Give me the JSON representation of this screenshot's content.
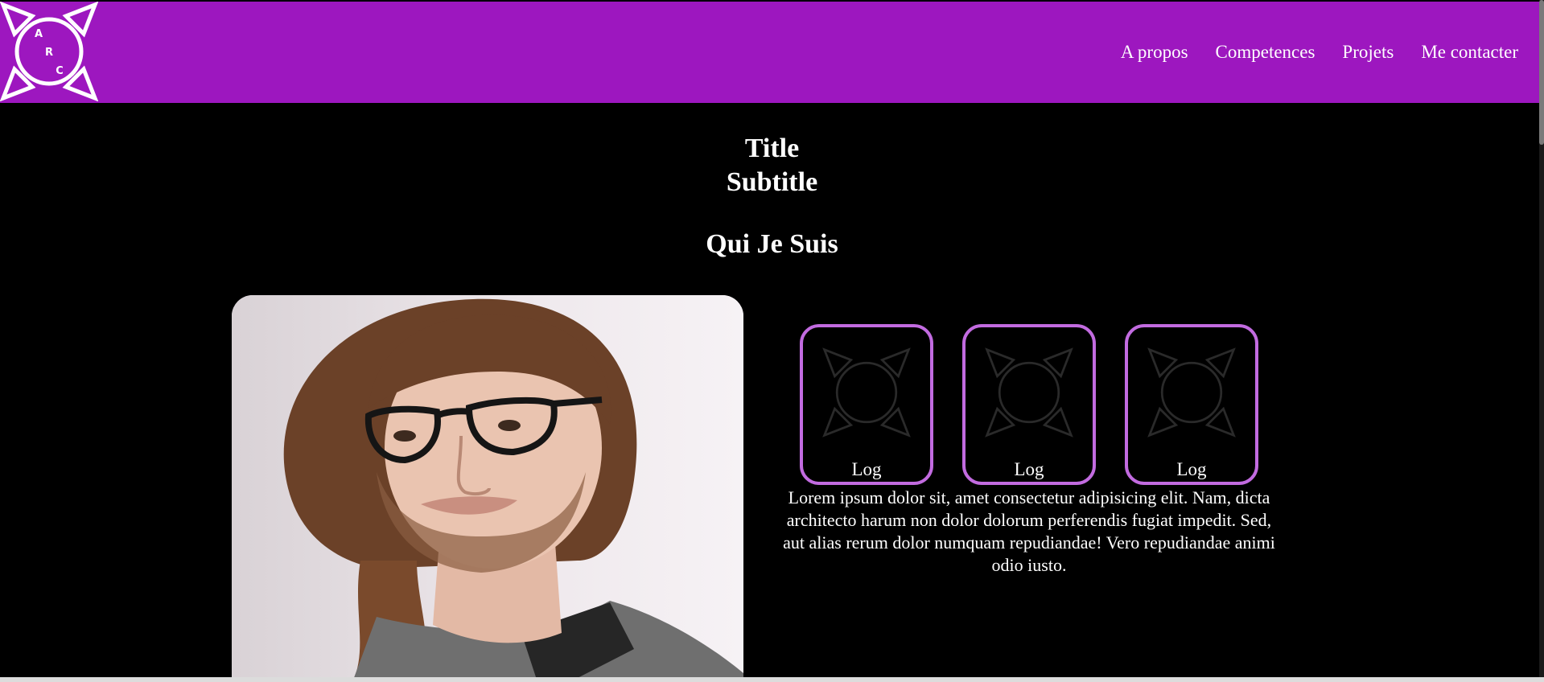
{
  "header": {
    "logo_letters": [
      "A",
      "R",
      "C"
    ],
    "nav": [
      "A propos",
      "Competences",
      "Projets",
      "Me contacter"
    ],
    "color": "#9d17bf"
  },
  "hero": {
    "title": "Title",
    "subtitle": "Subtitle"
  },
  "about": {
    "heading": "Qui Je Suis",
    "portrait": "photo-of-young-man-with-glasses",
    "cards": [
      {
        "label": "Log"
      },
      {
        "label": "Log"
      },
      {
        "label": "Log"
      }
    ],
    "text": "Lorem ipsum dolor sit, amet consectetur adipisicing elit. Nam, dicta architecto harum non dolor dolorum perferendis fugiat impedit. Sed, aut alias rerum dolor numquam repudiandae! Vero repudiandae animi odio iusto.",
    "card_border_color": "#c26be0"
  }
}
